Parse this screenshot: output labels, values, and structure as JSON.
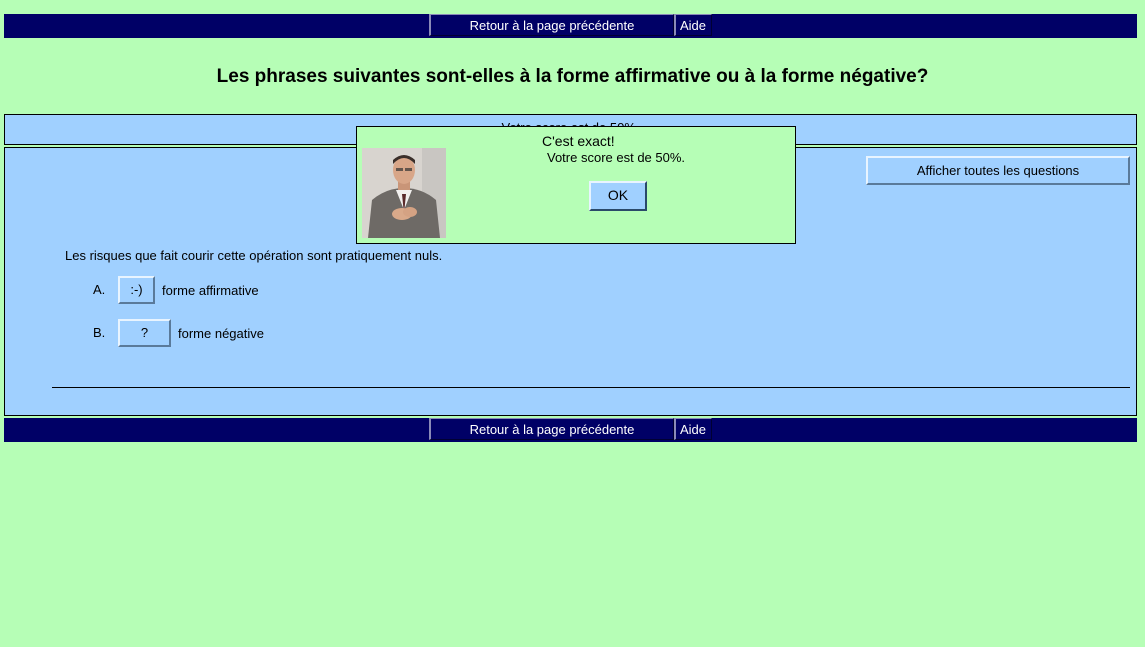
{
  "nav": {
    "back_label": "Retour à la page précédente",
    "help_label": "Aide"
  },
  "title": "Les phrases suivantes sont-elles à la forme affirmative ou à la forme négative?",
  "score_bar": {
    "text": "Votre score est de 50%."
  },
  "quiz": {
    "show_all_label": "Afficher toutes les questions",
    "question": "Les risques que fait courir cette opération sont pratiquement nuls.",
    "answers": [
      {
        "letter": "A.",
        "button": ":-)",
        "text": "forme affirmative"
      },
      {
        "letter": "B.",
        "button": "?",
        "text": "forme négative"
      }
    ]
  },
  "feedback": {
    "title": "C'est exact!",
    "message": "Votre score est de 50%.",
    "ok_label": "OK"
  },
  "colors": {
    "background": "#b6feb6",
    "navbar": "#000066",
    "panel": "#a0d0ff"
  }
}
